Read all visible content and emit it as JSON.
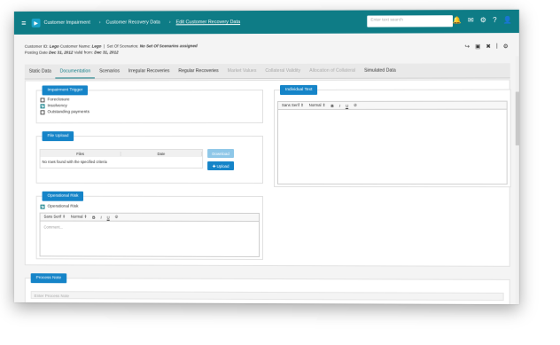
{
  "topbar": {
    "breadcrumbs": [
      "Customer Impairment",
      "Customer Recovery Data",
      "Edit Customer Recovery Data"
    ],
    "search_placeholder": "Enter text search"
  },
  "header": {
    "customer_id_label": "Customer ID:",
    "customer_id_value": "Lego",
    "customer_name_label": "Customer Name:",
    "customer_name_value": "Lego",
    "scenarios_label": "Set Of Scenarios:",
    "scenarios_value": "No Set Of Scenarios assigned",
    "posting_label": "Posting Date",
    "posting_value": "Dec 31, 2012",
    "valid_label": "Valid from:",
    "valid_value": "Dec 31, 2012"
  },
  "tabs": [
    {
      "label": "Static Data",
      "state": "normal"
    },
    {
      "label": "Documentation",
      "state": "active"
    },
    {
      "label": "Scenarios",
      "state": "normal"
    },
    {
      "label": "Irregular Recoveries",
      "state": "normal"
    },
    {
      "label": "Regular Recoveries",
      "state": "normal"
    },
    {
      "label": "Market Values",
      "state": "disabled"
    },
    {
      "label": "Collateral Validity",
      "state": "disabled"
    },
    {
      "label": "Allocation of Collateral",
      "state": "disabled"
    },
    {
      "label": "Simulated Data",
      "state": "normal"
    }
  ],
  "impairment": {
    "title": "Impairment Trigger",
    "options": [
      {
        "label": "Foreclosure",
        "checked": false
      },
      {
        "label": "Insolvency",
        "checked": true
      },
      {
        "label": "Outstanding payments",
        "checked": false
      }
    ]
  },
  "file_upload": {
    "title": "File Upload",
    "columns": [
      "Files",
      "Date"
    ],
    "empty_text": "No rows found with the specified criteria",
    "download_label": "Download",
    "upload_label": "Upload"
  },
  "operational_risk": {
    "title": "Operational Risk",
    "checkbox_label": "Operational Risk",
    "font_family": "Sans Serif",
    "font_size": "Normal",
    "placeholder": "Comment..."
  },
  "individual_text": {
    "title": "Individual Text",
    "font_family": "Sans Serif",
    "font_size": "Normal"
  },
  "process_note": {
    "title": "Process Note",
    "placeholder": "Enter Process Note"
  },
  "colors": {
    "topbar": "#0e7c86",
    "section_title": "#1584c8",
    "button_primary": "#1584c8",
    "button_disabled": "#8ec7e8"
  }
}
